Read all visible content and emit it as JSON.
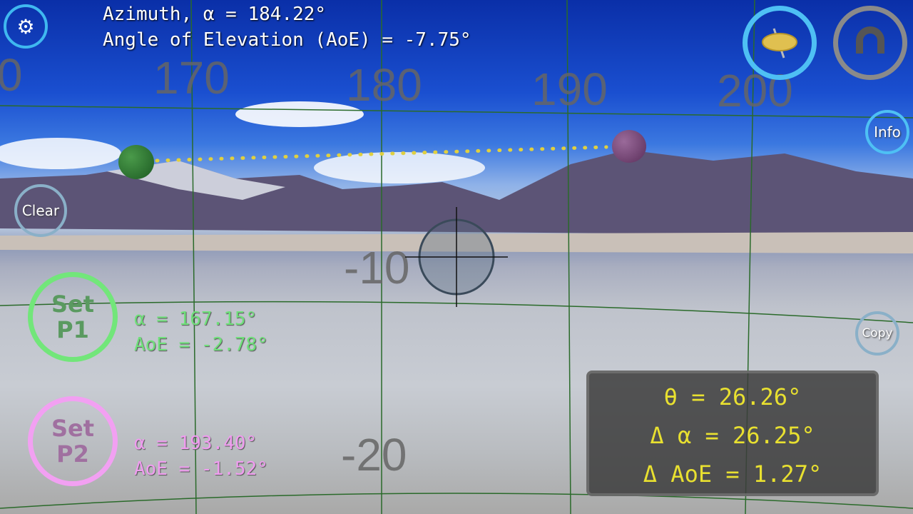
{
  "readout": {
    "azimuth": "Azimuth, α = 184.22°",
    "elevation": "Angle of Elevation (AoE) = -7.75°"
  },
  "azimuth_scale": [
    "0",
    "170",
    "180",
    "190",
    "200"
  ],
  "elevation_scale": [
    "-10",
    "-20"
  ],
  "buttons": {
    "settings": "settings-icon",
    "compass": "compass-icon",
    "magnet": "magnet-icon",
    "info": "Info",
    "clear": "Clear",
    "copy": "Copy",
    "set_p1": [
      "Set",
      "P1"
    ],
    "set_p2": [
      "Set",
      "P2"
    ]
  },
  "p1": {
    "alpha": "α = 167.15°",
    "aoe": "AoE = -2.78°",
    "color": "#6fe07a"
  },
  "p2": {
    "alpha": "α = 193.40°",
    "aoe": "AoE = -1.52°",
    "color": "#f09cf0"
  },
  "result": {
    "theta": "θ = 26.26°",
    "delta_alpha": "Δ α = 26.25°",
    "delta_aoe": "Δ AoE = 1.27°",
    "color": "#e8e030"
  },
  "colors": {
    "accent": "#3fb8f0",
    "grid": "#2a6a2a"
  }
}
